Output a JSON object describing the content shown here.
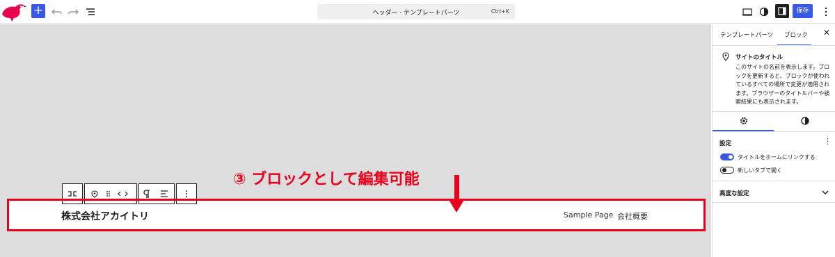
{
  "topbar": {
    "document_title": "ヘッダー · テンプレートパーツ",
    "shortcut": "Ctrl+K",
    "save_label": "保存",
    "add_label": "+"
  },
  "canvas": {
    "site_title": "株式会社アカイトリ",
    "nav": [
      "Sample Page",
      "会社概要"
    ]
  },
  "annotation": {
    "text": "③ ブロックとして編集可能"
  },
  "sidebar": {
    "tabs": [
      "テンプレートパーツ",
      "ブロック"
    ],
    "block_title": "サイトのタイトル",
    "block_description": "このサイトの名前を表示します。ブロックを更新すると、ブロックが使われているすべての場所で変更が適用されます。ブラウザーのタイトルバーや検索結果にも表示されます。",
    "settings_title": "設定",
    "toggles": [
      {
        "label": "タイトルをホームにリンクする",
        "on": true
      },
      {
        "label": "新しいタブで開く",
        "on": false
      }
    ],
    "advanced_title": "高度な設定"
  },
  "colors": {
    "accent": "#3858e9",
    "annotation": "#e8001c",
    "canvas_bg": "#dddddd"
  }
}
